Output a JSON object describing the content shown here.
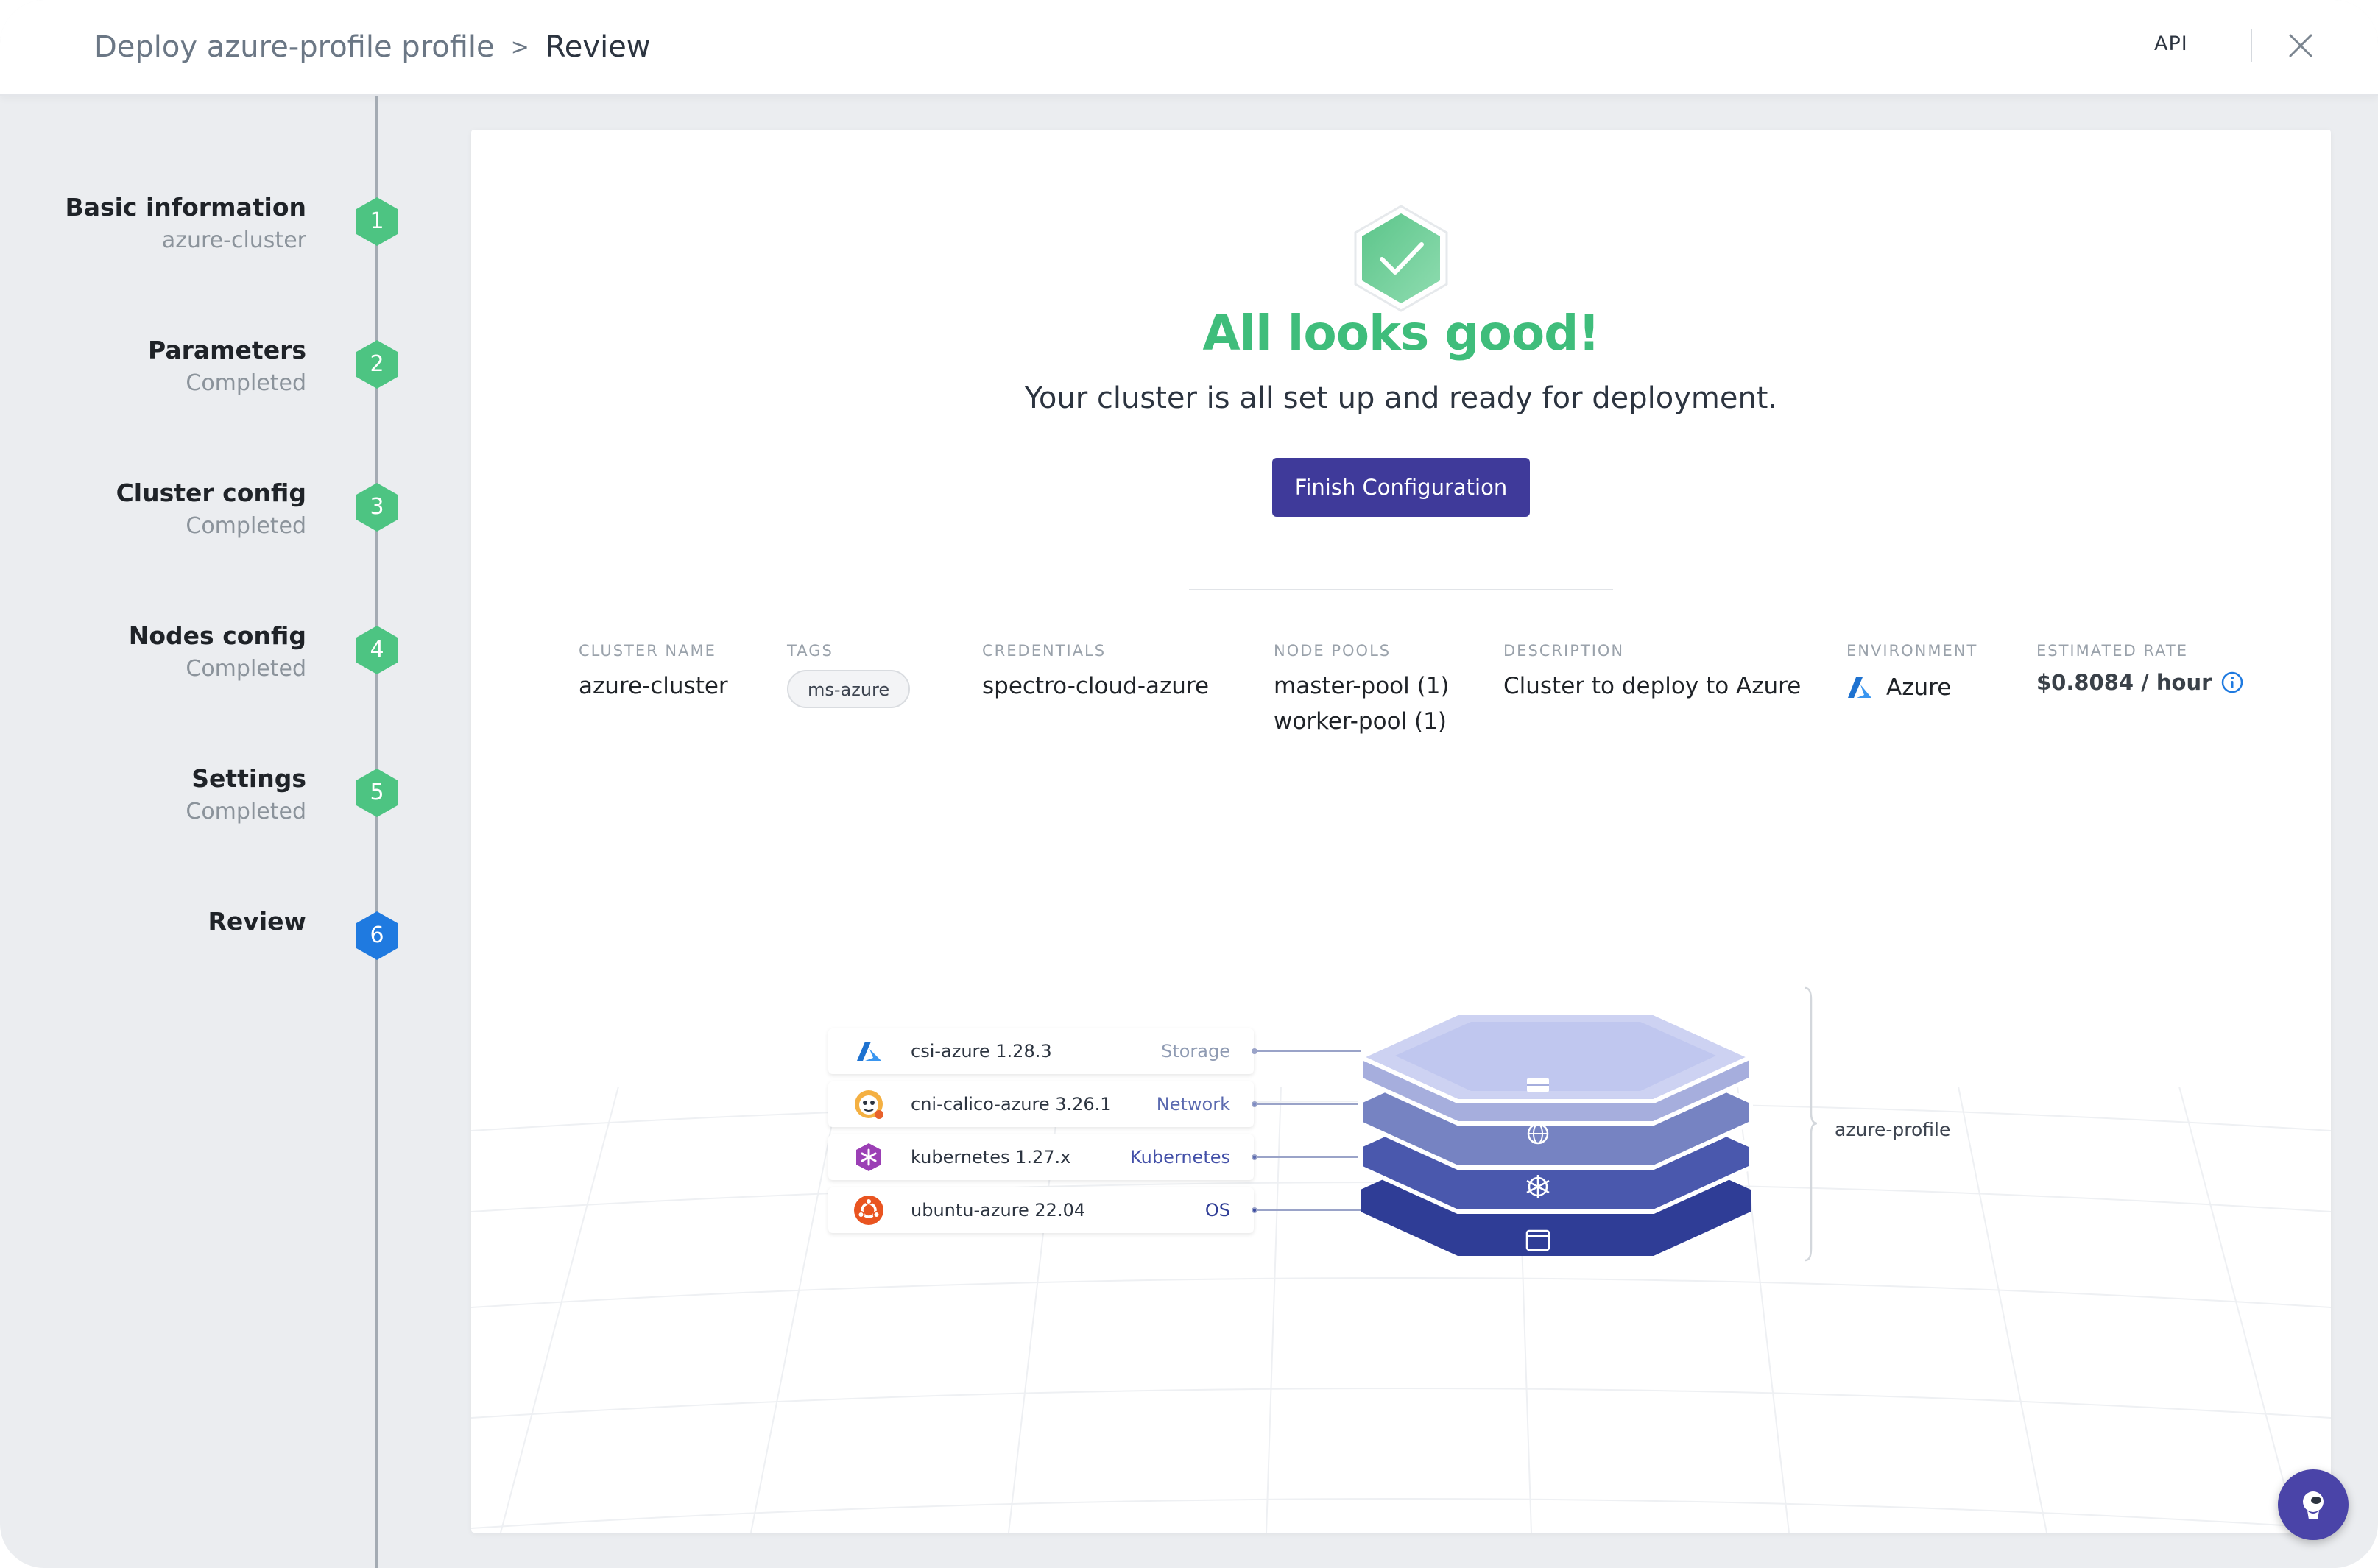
{
  "header": {
    "breadcrumb_root": "Deploy azure-profile profile",
    "breadcrumb_separator": ">",
    "breadcrumb_current": "Review",
    "api_label": "API"
  },
  "steps": [
    {
      "title": "Basic information",
      "subtitle": "azure-cluster",
      "number": "1",
      "state": "done"
    },
    {
      "title": "Parameters",
      "subtitle": "Completed",
      "number": "2",
      "state": "done"
    },
    {
      "title": "Cluster config",
      "subtitle": "Completed",
      "number": "3",
      "state": "done"
    },
    {
      "title": "Nodes config",
      "subtitle": "Completed",
      "number": "4",
      "state": "done"
    },
    {
      "title": "Settings",
      "subtitle": "Completed",
      "number": "5",
      "state": "done"
    },
    {
      "title": "Review",
      "subtitle": "",
      "number": "6",
      "state": "active"
    }
  ],
  "review": {
    "title": "All looks good!",
    "subtitle": "Your cluster is all set up and ready for deployment.",
    "finish_button": "Finish Configuration"
  },
  "summary": {
    "cluster_name": {
      "label": "CLUSTER NAME",
      "value": "azure-cluster"
    },
    "tags": {
      "label": "TAGS",
      "values": [
        "ms-azure"
      ]
    },
    "credentials": {
      "label": "CREDENTIALS",
      "value": "spectro-cloud-azure"
    },
    "node_pools": {
      "label": "NODE POOLS",
      "values": [
        "master-pool (1)",
        "worker-pool (1)"
      ]
    },
    "description": {
      "label": "DESCRIPTION",
      "value": "Cluster to deploy to Azure"
    },
    "environment": {
      "label": "ENVIRONMENT",
      "value": "Azure"
    },
    "estimated_rate": {
      "label": "ESTIMATED RATE",
      "value": "$0.8084 / hour"
    }
  },
  "profile": {
    "name": "azure-profile",
    "layers": [
      {
        "name": "csi-azure 1.28.3",
        "type": "Storage",
        "type_color": "#8f9bb3",
        "icon": "azure-icon"
      },
      {
        "name": "cni-calico-azure 3.26.1",
        "type": "Network",
        "type_color": "#5b6ab0",
        "icon": "calico-icon"
      },
      {
        "name": "kubernetes 1.27.x",
        "type": "Kubernetes",
        "type_color": "#4350a8",
        "icon": "kubernetes-icon"
      },
      {
        "name": "ubuntu-azure 22.04",
        "type": "OS",
        "type_color": "#2f3d96",
        "icon": "ubuntu-icon"
      }
    ]
  },
  "colors": {
    "success_green": "#3fbd7b",
    "primary_purple": "#3f3a9a",
    "step_done": "#4dc482",
    "step_active": "#1f7ae0"
  }
}
